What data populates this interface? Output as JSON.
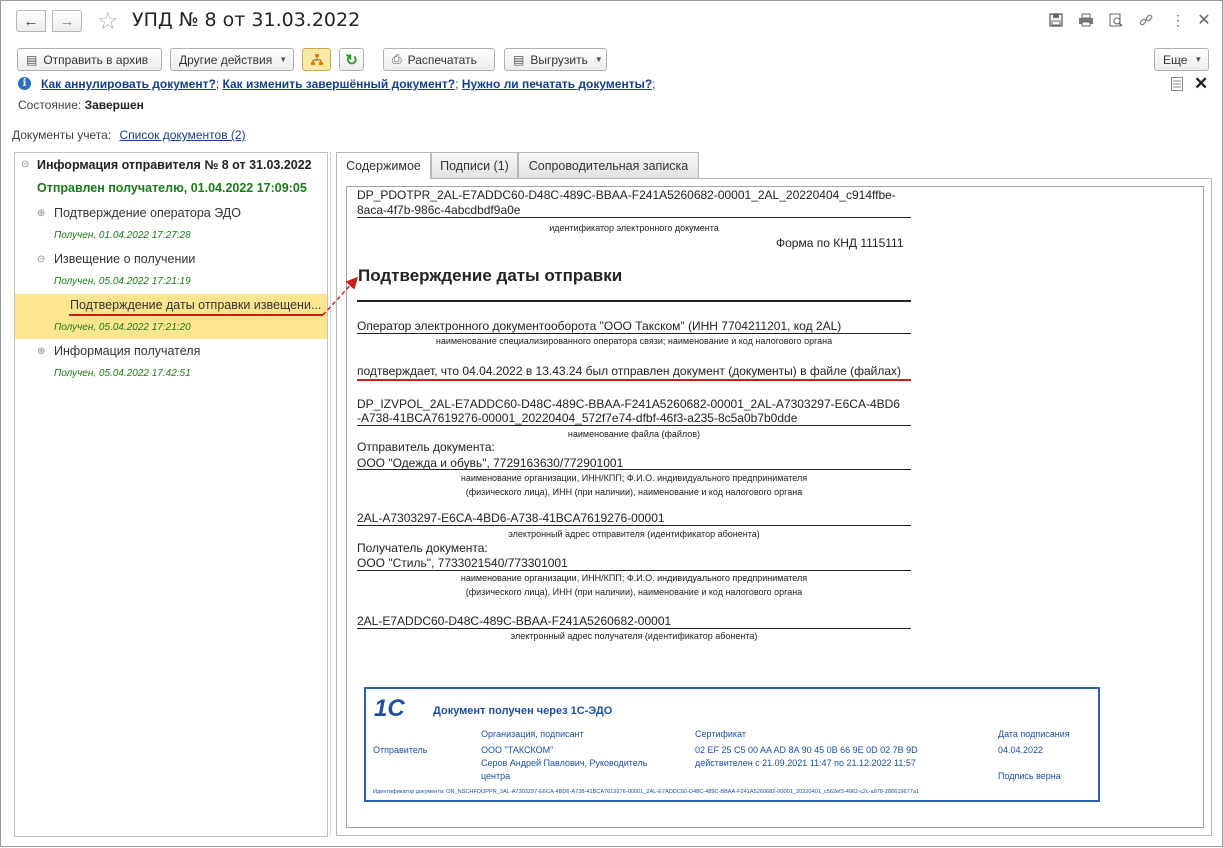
{
  "window": {
    "title": "УПД № 8 от 31.03.2022"
  },
  "toolbar": {
    "archive": "Отправить в архив",
    "other_actions": "Другие действия",
    "print": "Распечатать",
    "export": "Выгрузить",
    "more": "Еще"
  },
  "help": {
    "link1": "Как аннулировать документ?",
    "sep1": ";",
    "link2": "Как изменить завершённый документ?",
    "sep2": ";",
    "link3": "Нужно ли печатать документы?",
    "sep3": ";"
  },
  "state": {
    "label": "Состояние:",
    "value": "Завершен"
  },
  "docs": {
    "label": "Документы учета:",
    "link": "Список документов (2)"
  },
  "tree": {
    "root": "Информация отправителя № 8 от 31.03.2022",
    "root_status": "Отправлен получателю, 01.04.2022 17:09:05",
    "items": [
      {
        "label": "Подтверждение оператора ЭДО",
        "date": "Получен, 01.04.2022 17:27:28"
      },
      {
        "label": "Извещение о получении",
        "date": "Получен, 05.04.2022 17:21:19"
      },
      {
        "label": "Подтверждение даты отправки извещени...",
        "date": "Получен, 05.04.2022 17:21:20"
      },
      {
        "label": "Информация получателя",
        "date": "Получен, 05.04.2022 17:42:51"
      }
    ]
  },
  "tabs": [
    "Содержимое",
    "Подписи (1)",
    "Сопроводительная записка"
  ],
  "document": {
    "file_id_line1": "DP_PDOTPR_2AL-E7ADDC60-D48C-489C-BBAA-F241A5260682-00001_2AL_20220404_c914ffbe-",
    "file_id_line2": "8aca-4f7b-986c-4abcdbdf9a0e",
    "file_id_caption": "идентификатор электронного документа",
    "knd": "Форма по КНД 1115111",
    "heading": "Подтверждение даты отправки",
    "operator": "Оператор электронного документооборота \"ООО Такском\" (ИНН 7704211201, код 2AL)",
    "operator_caption": "наименование специализированного оператора связи; наименование и код налогового органа",
    "confirms": "подтверждает, что 04.04.2022 в 13.43.24 был отправлен документ (документы) в файле (файлах)",
    "filename_line1": "DP_IZVPOL_2AL-E7ADDC60-D48C-489C-BBAA-F241A5260682-00001_2AL-A7303297-E6CA-4BD6",
    "filename_line2": "-A738-41BCA7619276-00001_20220404_572f7e74-dfbf-46f3-a235-8c5a0b7b0dde",
    "filename_caption": "наименование файла (файлов)",
    "sender_label": "Отправитель документа:",
    "sender": "ООО \"Одежда и обувь\", 7729163630/772901001",
    "org_caption_1": "наименование организации, ИНН/КПП; Ф.И.О. индивидуального предпринимателя",
    "org_caption_2": "(физического лица), ИНН (при наличии), наименование и код налогового органа",
    "sender_addr": "2AL-A7303297-E6CA-4BD6-A738-41BCA7619276-00001",
    "sender_addr_caption": "электронный адрес отправителя (идентификатор абонента)",
    "recipient_label": "Получатель документа:",
    "recipient": "ООО \"Стиль\", 7733021540/773301001",
    "recipient_addr": "2AL-E7ADDC60-D48C-489C-BBAA-F241A5260682-00001",
    "recipient_addr_caption": "электронный адрес получателя (идентификатор абонента)"
  },
  "stamp": {
    "logo": "1С",
    "title": "Документ получен через 1С-ЭДО",
    "col_org": "Организация, подписант",
    "col_cert": "Сертификат",
    "col_date": "Дата подписания",
    "role": "Отправитель",
    "org": "ООО \"ТАКСКОМ\"",
    "signer_1": "Серов Андрей Павлович, Руководитель",
    "signer_2": "центра",
    "cert": "02 EF 25 C5 00 AA AD 8A 90 45 0B 66 9E 0D 02 7B 9D",
    "validity": "действителен с 21.09.2021 11:47 по 21.12.2022 11:57",
    "date": "04.04.2022",
    "verified": "Подпись верна",
    "doc_id": "Идентификатор документа: ON_NSCHFDOPPR_2AL-A7303297-E6CA-4BD6-A738-41BCA7619276-00001_2AL-E7ADDC60-D48C-489C-BBAA-F241A5260682-00001_20220401_c562ef3-4962-c2c-a978-286619677a1"
  },
  "colors": {
    "selection": "#fbe58e",
    "link": "#163f8a",
    "green": "#1a7a17",
    "annotation": "#cc1d1d",
    "stamp_blue": "#1e4fa0"
  }
}
